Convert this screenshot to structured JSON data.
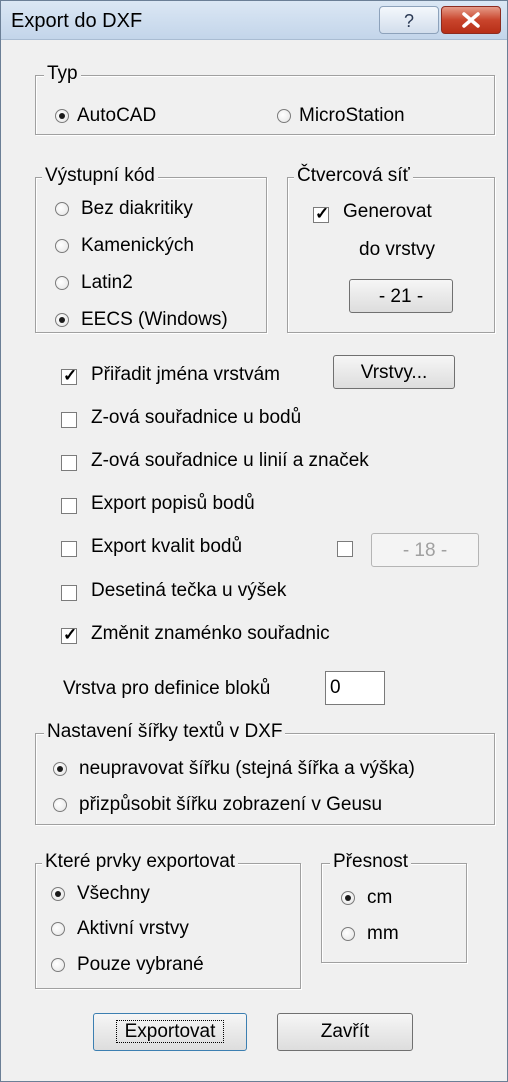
{
  "window": {
    "title": "Export do DXF"
  },
  "typ": {
    "legend": "Typ",
    "autocad": "AutoCAD",
    "microstation": "MicroStation",
    "selected": "AutoCAD"
  },
  "vystupni_kod": {
    "legend": "Výstupní kód",
    "options": [
      "Bez diakritiky",
      "Kamenických",
      "Latin2",
      "EECS (Windows)"
    ],
    "selected": "EECS (Windows)"
  },
  "ctvercova_sit": {
    "legend": "Čtvercová síť",
    "generovat": "Generovat",
    "generovat_checked": true,
    "do_vrstvy": "do vrstvy",
    "layer_button": "- 21 -"
  },
  "options": {
    "prirazit": "Přiřadit jména vrstvám",
    "vrstvy_button": "Vrstvy...",
    "z_body": "Z-ová souřadnice u bodů",
    "z_linie": "Z-ová souřadnice u linií a značek",
    "popisy": "Export popisů bodů",
    "kvality": "Export kvalit bodů",
    "kvality_button": "- 18 -",
    "desetinna": "Desetiná tečka u výšek",
    "zmenit": "Změnit znaménko souřadnic",
    "vrstva_bloky_label": "Vrstva pro definice bloků",
    "vrstva_bloky_value": "0"
  },
  "sirka": {
    "legend": "Nastavení šířky textů v DXF",
    "neupravovat": "neupravovat šířku (stejná šířka a výška)",
    "prizpusobit": "přizpůsobit šířku zobrazení v Geusu",
    "selected": "neupravovat"
  },
  "prvky": {
    "legend": "Které prvky exportovat",
    "options": [
      "Všechny",
      "Aktivní vrstvy",
      "Pouze vybrané"
    ],
    "selected": "Všechny"
  },
  "presnost": {
    "legend": "Přesnost",
    "options": [
      "cm",
      "mm"
    ],
    "selected": "cm"
  },
  "buttons": {
    "export": "Exportovat",
    "close": "Zavřít"
  }
}
